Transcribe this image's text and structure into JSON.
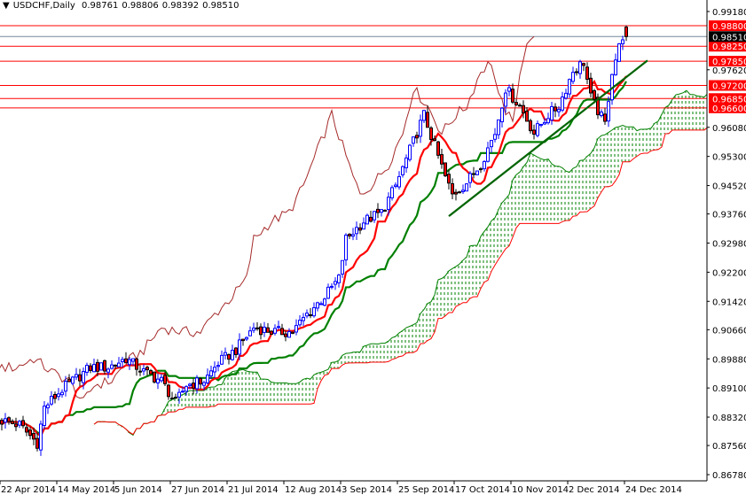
{
  "header": {
    "symbol": "USDCHF,Daily",
    "open": "0.98761",
    "high": "0.98806",
    "low": "0.98392",
    "close": "0.98510"
  },
  "chart_data": {
    "type": "candlestick",
    "title": "USDCHF,Daily",
    "indicator": "Ichimoku Kinko Hyo (9,26,52)",
    "ylim": [
      0.8678,
      0.9918
    ],
    "y_ticks": [
      "0.99180",
      "0.97620",
      "0.96080",
      "0.95300",
      "0.94520",
      "0.93760",
      "0.92980",
      "0.92200",
      "0.91420",
      "0.90660",
      "0.89880",
      "0.89100",
      "0.88320",
      "0.87560",
      "0.86780"
    ],
    "x_ticks": [
      "22 Apr 2014",
      "14 May 2014",
      "5 Jun 2014",
      "27 Jun 2014",
      "21 Jul 2014",
      "12 Aug 2014",
      "3 Sep 2014",
      "25 Sep 2014",
      "17 Oct 2014",
      "10 Nov 2014",
      "2 Dec 2014",
      "24 Dec 2014"
    ],
    "x_tick_bar_index": [
      0,
      16,
      32,
      48,
      64,
      80,
      96,
      112,
      128,
      144,
      160,
      176
    ],
    "close_waypoints": [
      [
        0,
        0.8823
      ],
      [
        5,
        0.8811
      ],
      [
        10,
        0.8763
      ],
      [
        12,
        0.8858
      ],
      [
        17,
        0.8906
      ],
      [
        25,
        0.8965
      ],
      [
        30,
        0.8965
      ],
      [
        35,
        0.8989
      ],
      [
        40,
        0.8953
      ],
      [
        45,
        0.8929
      ],
      [
        49,
        0.887
      ],
      [
        52,
        0.8918
      ],
      [
        57,
        0.8929
      ],
      [
        61,
        0.8977
      ],
      [
        66,
        0.9012
      ],
      [
        71,
        0.9072
      ],
      [
        77,
        0.906
      ],
      [
        82,
        0.906
      ],
      [
        86,
        0.9107
      ],
      [
        91,
        0.9155
      ],
      [
        95,
        0.9202
      ],
      [
        97,
        0.9309
      ],
      [
        102,
        0.9356
      ],
      [
        107,
        0.938
      ],
      [
        111,
        0.9451
      ],
      [
        115,
        0.9546
      ],
      [
        119,
        0.9641
      ],
      [
        122,
        0.9558
      ],
      [
        125,
        0.9475
      ],
      [
        127,
        0.9427
      ],
      [
        131,
        0.946
      ],
      [
        135,
        0.951
      ],
      [
        139,
        0.9593
      ],
      [
        142,
        0.9712
      ],
      [
        146,
        0.9665
      ],
      [
        150,
        0.9593
      ],
      [
        154,
        0.9641
      ],
      [
        157,
        0.9665
      ],
      [
        161,
        0.9759
      ],
      [
        164,
        0.9783
      ],
      [
        166,
        0.9688
      ],
      [
        170,
        0.9617
      ],
      [
        172,
        0.9759
      ],
      [
        175,
        0.9854
      ],
      [
        176,
        0.9851
      ]
    ],
    "last_bar": {
      "open": 0.98761,
      "high": 0.98806,
      "low": 0.98392,
      "close": 0.9851
    },
    "levels": [
      {
        "price": 0.988,
        "label": "0.98800",
        "color": "#ff0000"
      },
      {
        "price": 0.9825,
        "label": "0.98250",
        "color": "#ff0000"
      },
      {
        "price": 0.9785,
        "label": "0.97850",
        "color": "#ff0000"
      },
      {
        "price": 0.972,
        "label": "0.97200",
        "color": "#ff0000"
      },
      {
        "price": 0.9685,
        "label": "0.96850",
        "color": "#ff0000"
      },
      {
        "price": 0.966,
        "label": "0.96600",
        "color": "#ff0000"
      }
    ],
    "current_price": {
      "price": 0.9851,
      "label": "0.98510",
      "color": "#000000"
    },
    "trendline": {
      "from": [
        126,
        0.937
      ],
      "to": [
        182,
        0.9787
      ],
      "color": "#006400"
    },
    "colors": {
      "bull": "#0000ff",
      "bear": "#ff0000",
      "tenkan": "#ff0000",
      "kijun": "#008000",
      "chikou": "#a52a2a",
      "cloud_up": "#008000",
      "cloud_down": "#ff0000"
    }
  }
}
